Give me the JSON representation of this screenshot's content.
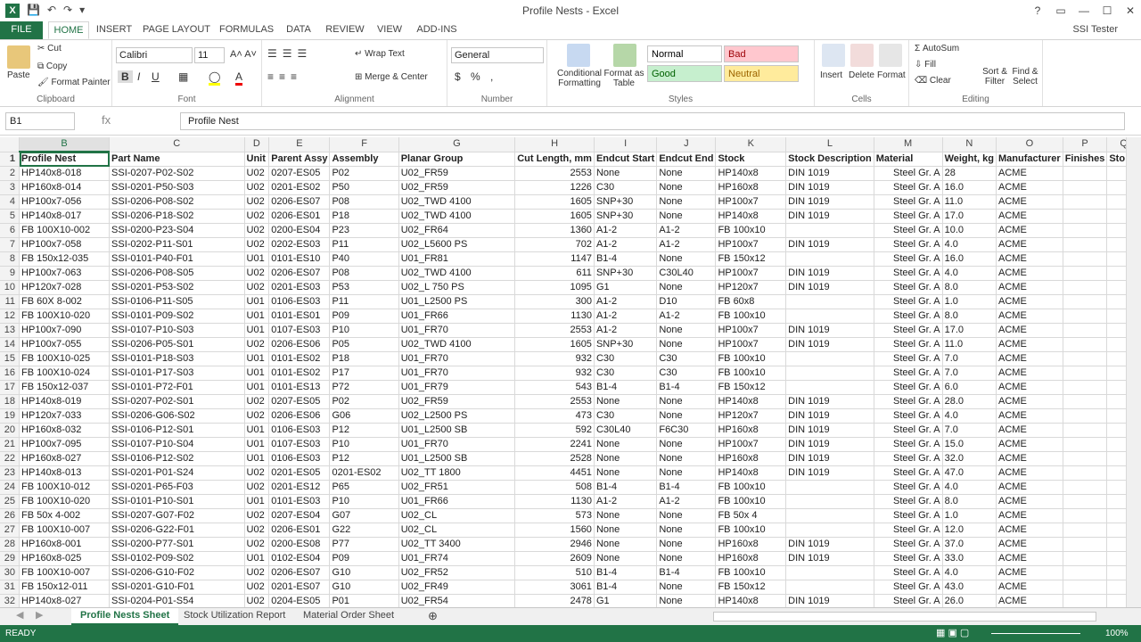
{
  "window": {
    "title": "Profile Nests - Excel",
    "user": "SSI Tester",
    "window_controls": [
      "?",
      "▭",
      "—",
      "☐",
      "✕"
    ]
  },
  "ribbon_tabs": [
    "FILE",
    "HOME",
    "INSERT",
    "PAGE LAYOUT",
    "FORMULAS",
    "DATA",
    "REVIEW",
    "VIEW",
    "ADD-INS"
  ],
  "ribbon": {
    "clipboard": {
      "label": "Clipboard",
      "paste": "Paste",
      "cut": "Cut",
      "copy": "Copy",
      "format_painter": "Format Painter"
    },
    "font": {
      "label": "Font",
      "name": "Calibri",
      "size": "11"
    },
    "alignment": {
      "label": "Alignment",
      "wrap": "Wrap Text",
      "merge": "Merge & Center"
    },
    "number": {
      "label": "Number",
      "format": "General"
    },
    "styles": {
      "label": "Styles",
      "conditional": "Conditional Formatting",
      "format_table": "Format as Table",
      "cells": [
        {
          "name": "Normal",
          "bg": "#ffffff",
          "fg": "#000000"
        },
        {
          "name": "Bad",
          "bg": "#ffc7ce",
          "fg": "#9c0006"
        },
        {
          "name": "Good",
          "bg": "#c6efce",
          "fg": "#006100"
        },
        {
          "name": "Neutral",
          "bg": "#ffeb9c",
          "fg": "#9c6500"
        }
      ]
    },
    "cells_group": {
      "label": "Cells",
      "insert": "Insert",
      "delete": "Delete",
      "format": "Format"
    },
    "editing": {
      "label": "Editing",
      "autosum": "AutoSum",
      "fill": "Fill",
      "clear": "Clear",
      "sort": "Sort & Filter",
      "find": "Find & Select"
    }
  },
  "formula_bar": {
    "name_box": "B1",
    "fx": "fx",
    "value": "Profile Nest"
  },
  "columns": [
    "B",
    "C",
    "D",
    "E",
    "F",
    "G",
    "H",
    "I",
    "J",
    "K",
    "L",
    "M",
    "N",
    "O",
    "P",
    "Q"
  ],
  "headers": [
    "Profile Nest",
    "Part Name",
    "Unit",
    "Parent Assy",
    "Assembly",
    "Planar Group",
    "Cut Length, mm",
    "Endcut Start",
    "Endcut End",
    "Stock",
    "Stock Description",
    "Material",
    "Weight, kg",
    "Manufacturer",
    "Finishes",
    "Sto"
  ],
  "rows": [
    [
      "HP140x8-018",
      "SSI-0207-P02-S02",
      "U02",
      "0207-ES05",
      "P02",
      "U02_FR59",
      "2553",
      "None",
      "None",
      "HP140x8",
      "DIN 1019",
      "Steel Gr. A",
      "28",
      "ACME",
      "",
      ""
    ],
    [
      "HP160x8-014",
      "SSI-0201-P50-S03",
      "U02",
      "0201-ES02",
      "P50",
      "U02_FR59",
      "1226",
      "C30",
      "None",
      "HP160x8",
      "DIN 1019",
      "Steel Gr. A",
      "16.0",
      "ACME",
      "",
      ""
    ],
    [
      "HP100x7-056",
      "SSI-0206-P08-S02",
      "U02",
      "0206-ES07",
      "P08",
      "U02_TWD 4100",
      "1605",
      "SNP+30",
      "None",
      "HP100x7",
      "DIN 1019",
      "Steel Gr. A",
      "11.0",
      "ACME",
      "",
      ""
    ],
    [
      "HP140x8-017",
      "SSI-0206-P18-S02",
      "U02",
      "0206-ES01",
      "P18",
      "U02_TWD 4100",
      "1605",
      "SNP+30",
      "None",
      "HP140x8",
      "DIN 1019",
      "Steel Gr. A",
      "17.0",
      "ACME",
      "",
      ""
    ],
    [
      "FB 100X10-002",
      "SSI-0200-P23-S04",
      "U02",
      "0200-ES04",
      "P23",
      "U02_FR64",
      "1360",
      "A1-2",
      "A1-2",
      "FB 100x10",
      "",
      "Steel Gr. A",
      "10.0",
      "ACME",
      "",
      ""
    ],
    [
      "HP100x7-058",
      "SSI-0202-P11-S01",
      "U02",
      "0202-ES03",
      "P11",
      "U02_L5600 PS",
      "702",
      "A1-2",
      "A1-2",
      "HP100x7",
      "DIN 1019",
      "Steel Gr. A",
      "4.0",
      "ACME",
      "",
      ""
    ],
    [
      "FB 150x12-035",
      "SSI-0101-P40-F01",
      "U01",
      "0101-ES10",
      "P40",
      "U01_FR81",
      "1147",
      "B1-4",
      "None",
      "FB 150x12",
      "",
      "Steel Gr. A",
      "16.0",
      "ACME",
      "",
      ""
    ],
    [
      "HP100x7-063",
      "SSI-0206-P08-S05",
      "U02",
      "0206-ES07",
      "P08",
      "U02_TWD 4100",
      "611",
      "SNP+30",
      "C30L40",
      "HP100x7",
      "DIN 1019",
      "Steel Gr. A",
      "4.0",
      "ACME",
      "",
      ""
    ],
    [
      "HP120x7-028",
      "SSI-0201-P53-S02",
      "U02",
      "0201-ES03",
      "P53",
      "U02_L 750 PS",
      "1095",
      "G1",
      "None",
      "HP120x7",
      "DIN 1019",
      "Steel Gr. A",
      "8.0",
      "ACME",
      "",
      ""
    ],
    [
      "FB  60X 8-002",
      "SSI-0106-P11-S05",
      "U01",
      "0106-ES03",
      "P11",
      "U01_L2500 PS",
      "300",
      "A1-2",
      "D10",
      "FB 60x8",
      "",
      "Steel Gr. A",
      "1.0",
      "ACME",
      "",
      ""
    ],
    [
      "FB 100X10-020",
      "SSI-0101-P09-S02",
      "U01",
      "0101-ES01",
      "P09",
      "U01_FR66",
      "1130",
      "A1-2",
      "A1-2",
      "FB 100x10",
      "",
      "Steel Gr. A",
      "8.0",
      "ACME",
      "",
      ""
    ],
    [
      "HP100x7-090",
      "SSI-0107-P10-S03",
      "U01",
      "0107-ES03",
      "P10",
      "U01_FR70",
      "2553",
      "A1-2",
      "None",
      "HP100x7",
      "DIN 1019",
      "Steel Gr. A",
      "17.0",
      "ACME",
      "",
      ""
    ],
    [
      "HP100x7-055",
      "SSI-0206-P05-S01",
      "U02",
      "0206-ES06",
      "P05",
      "U02_TWD 4100",
      "1605",
      "SNP+30",
      "None",
      "HP100x7",
      "DIN 1019",
      "Steel Gr. A",
      "11.0",
      "ACME",
      "",
      ""
    ],
    [
      "FB 100X10-025",
      "SSI-0101-P18-S03",
      "U01",
      "0101-ES02",
      "P18",
      "U01_FR70",
      "932",
      "C30",
      "C30",
      "FB 100x10",
      "",
      "Steel Gr. A",
      "7.0",
      "ACME",
      "",
      ""
    ],
    [
      "FB 100X10-024",
      "SSI-0101-P17-S03",
      "U01",
      "0101-ES02",
      "P17",
      "U01_FR70",
      "932",
      "C30",
      "C30",
      "FB 100x10",
      "",
      "Steel Gr. A",
      "7.0",
      "ACME",
      "",
      ""
    ],
    [
      "FB 150x12-037",
      "SSI-0101-P72-F01",
      "U01",
      "0101-ES13",
      "P72",
      "U01_FR79",
      "543",
      "B1-4",
      "B1-4",
      "FB 150x12",
      "",
      "Steel Gr. A",
      "6.0",
      "ACME",
      "",
      ""
    ],
    [
      "HP140x8-019",
      "SSI-0207-P02-S01",
      "U02",
      "0207-ES05",
      "P02",
      "U02_FR59",
      "2553",
      "None",
      "None",
      "HP140x8",
      "DIN 1019",
      "Steel Gr. A",
      "28.0",
      "ACME",
      "",
      ""
    ],
    [
      "HP120x7-033",
      "SSI-0206-G06-S02",
      "U02",
      "0206-ES06",
      "G06",
      "U02_L2500 PS",
      "473",
      "C30",
      "None",
      "HP120x7",
      "DIN 1019",
      "Steel Gr. A",
      "4.0",
      "ACME",
      "",
      ""
    ],
    [
      "HP160x8-032",
      "SSI-0106-P12-S01",
      "U01",
      "0106-ES03",
      "P12",
      "U01_L2500 SB",
      "592",
      "C30L40",
      "F6C30",
      "HP160x8",
      "DIN 1019",
      "Steel Gr. A",
      "7.0",
      "ACME",
      "",
      ""
    ],
    [
      "HP100x7-095",
      "SSI-0107-P10-S04",
      "U01",
      "0107-ES03",
      "P10",
      "U01_FR70",
      "2241",
      "None",
      "None",
      "HP100x7",
      "DIN 1019",
      "Steel Gr. A",
      "15.0",
      "ACME",
      "",
      ""
    ],
    [
      "HP160x8-027",
      "SSI-0106-P12-S02",
      "U01",
      "0106-ES03",
      "P12",
      "U01_L2500 SB",
      "2528",
      "None",
      "None",
      "HP160x8",
      "DIN 1019",
      "Steel Gr. A",
      "32.0",
      "ACME",
      "",
      ""
    ],
    [
      "HP140x8-013",
      "SSI-0201-P01-S24",
      "U02",
      "0201-ES05",
      "0201-ES02",
      "U02_TT 1800",
      "4451",
      "None",
      "None",
      "HP140x8",
      "DIN 1019",
      "Steel Gr. A",
      "47.0",
      "ACME",
      "",
      ""
    ],
    [
      "FB 100X10-012",
      "SSI-0201-P65-F03",
      "U02",
      "0201-ES12",
      "P65",
      "U02_FR51",
      "508",
      "B1-4",
      "B1-4",
      "FB 100x10",
      "",
      "Steel Gr. A",
      "4.0",
      "ACME",
      "",
      ""
    ],
    [
      "FB 100X10-020",
      "SSI-0101-P10-S01",
      "U01",
      "0101-ES03",
      "P10",
      "U01_FR66",
      "1130",
      "A1-2",
      "A1-2",
      "FB 100x10",
      "",
      "Steel Gr. A",
      "8.0",
      "ACME",
      "",
      ""
    ],
    [
      "FB  50x 4-002",
      "SSI-0207-G07-F02",
      "U02",
      "0207-ES04",
      "G07",
      "U02_CL",
      "573",
      "None",
      "None",
      "FB 50x 4",
      "",
      "Steel Gr. A",
      "1.0",
      "ACME",
      "",
      ""
    ],
    [
      "FB 100X10-007",
      "SSI-0206-G22-F01",
      "U02",
      "0206-ES01",
      "G22",
      "U02_CL",
      "1560",
      "None",
      "None",
      "FB 100x10",
      "",
      "Steel Gr. A",
      "12.0",
      "ACME",
      "",
      ""
    ],
    [
      "HP160x8-001",
      "SSI-0200-P77-S01",
      "U02",
      "0200-ES08",
      "P77",
      "U02_TT 3400",
      "2946",
      "None",
      "None",
      "HP160x8",
      "DIN 1019",
      "Steel Gr. A",
      "37.0",
      "ACME",
      "",
      ""
    ],
    [
      "HP160x8-025",
      "SSI-0102-P09-S02",
      "U01",
      "0102-ES04",
      "P09",
      "U01_FR74",
      "2609",
      "None",
      "None",
      "HP160x8",
      "DIN 1019",
      "Steel Gr. A",
      "33.0",
      "ACME",
      "",
      ""
    ],
    [
      "FB 100X10-007",
      "SSI-0206-G10-F02",
      "U02",
      "0206-ES07",
      "G10",
      "U02_FR52",
      "510",
      "B1-4",
      "B1-4",
      "FB 100x10",
      "",
      "Steel Gr. A",
      "4.0",
      "ACME",
      "",
      ""
    ],
    [
      "FB 150x12-011",
      "SSI-0201-G10-F01",
      "U02",
      "0201-ES07",
      "G10",
      "U02_FR49",
      "3061",
      "B1-4",
      "None",
      "FB 150x12",
      "",
      "Steel Gr. A",
      "43.0",
      "ACME",
      "",
      ""
    ],
    [
      "HP140x8-027",
      "SSI-0204-P01-S54",
      "U02",
      "0204-ES05",
      "P01",
      "U02_FR54",
      "2478",
      "G1",
      "None",
      "HP140x8",
      "DIN 1019",
      "Steel Gr. A",
      "26.0",
      "ACME",
      "",
      ""
    ]
  ],
  "sheets": [
    "Profile Nests Sheet",
    "Stock Utilization Report",
    "Material Order Sheet"
  ],
  "status": {
    "ready": "READY",
    "zoom": "100%"
  }
}
